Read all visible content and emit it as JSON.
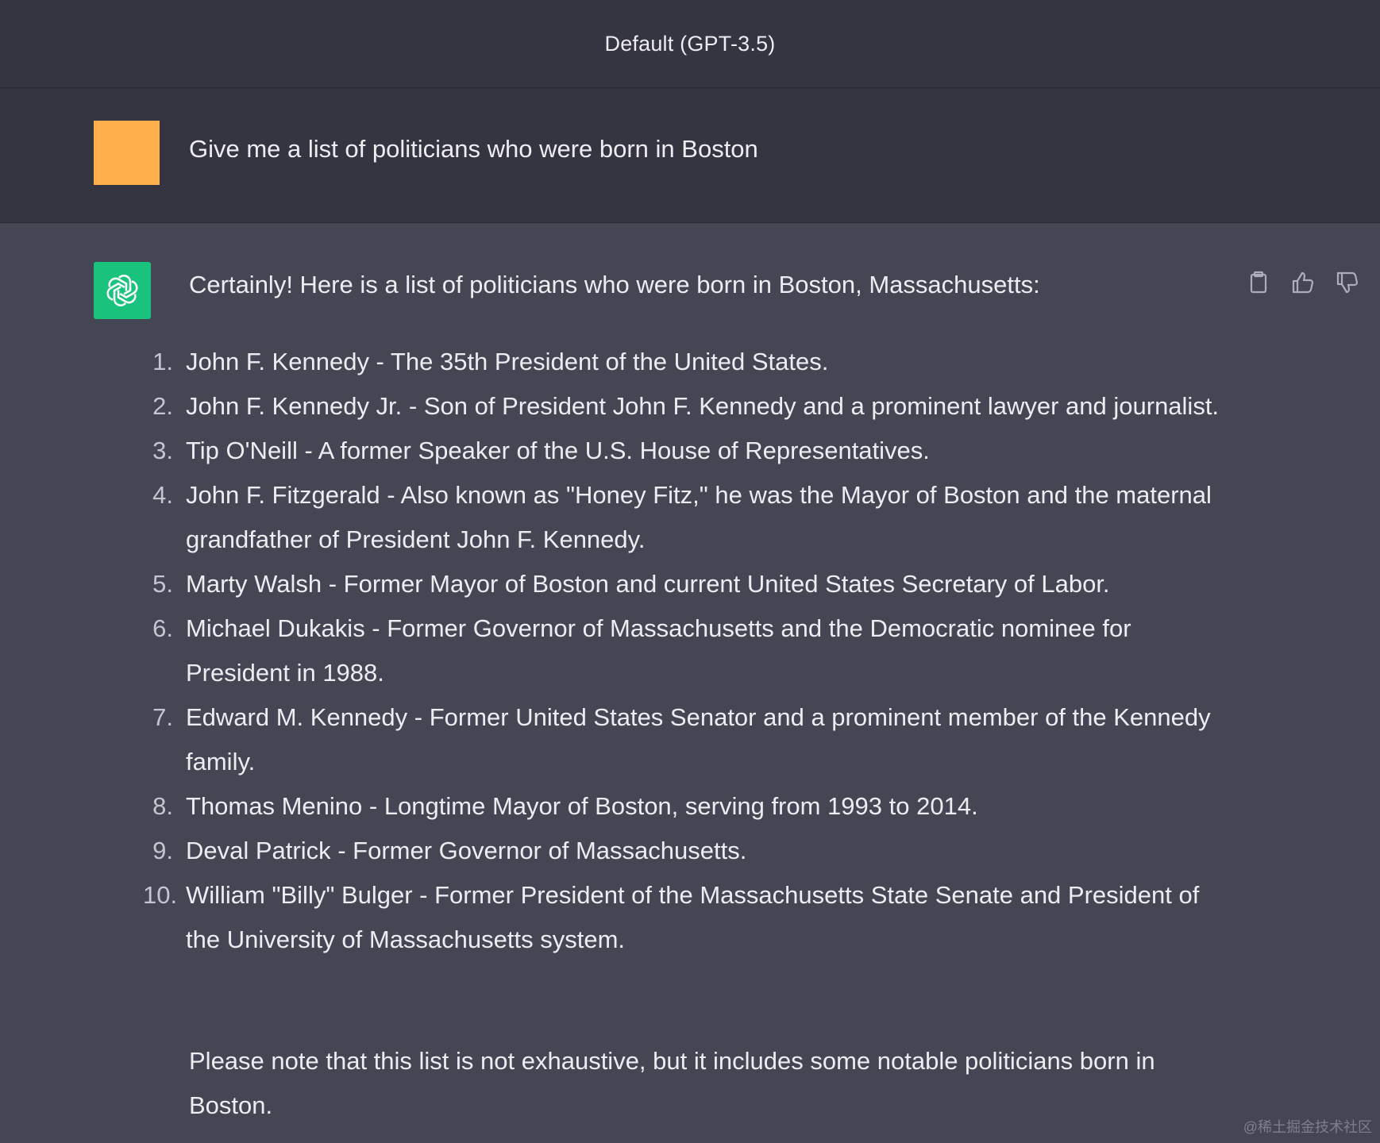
{
  "header": {
    "title": "Default (GPT-3.5)"
  },
  "user_message": {
    "text": "Give me a list of politicians who were born in Boston",
    "avatar_color": "#ffb04c"
  },
  "assistant_message": {
    "avatar_color": "#19c37d",
    "intro": "Certainly! Here is a list of politicians who were born in Boston, Massachusetts:",
    "items": [
      {
        "num": "1.",
        "text": "John F. Kennedy - The 35th President of the United States."
      },
      {
        "num": "2.",
        "text": "John F. Kennedy Jr. - Son of President John F. Kennedy and a prominent lawyer and journalist."
      },
      {
        "num": "3.",
        "text": "Tip O'Neill - A former Speaker of the U.S. House of Representatives."
      },
      {
        "num": "4.",
        "text": "John F. Fitzgerald - Also known as \"Honey Fitz,\" he was the Mayor of Boston and the maternal grandfather of President John F. Kennedy."
      },
      {
        "num": "5.",
        "text": "Marty Walsh - Former Mayor of Boston and current United States Secretary of Labor."
      },
      {
        "num": "6.",
        "text": "Michael Dukakis - Former Governor of Massachusetts and the Democratic nominee for President in 1988."
      },
      {
        "num": "7.",
        "text": "Edward M. Kennedy - Former United States Senator and a prominent member of the Kennedy family."
      },
      {
        "num": "8.",
        "text": "Thomas Menino - Longtime Mayor of Boston, serving from 1993 to 2014."
      },
      {
        "num": "9.",
        "text": "Deval Patrick - Former Governor of Massachusetts."
      },
      {
        "num": "10.",
        "text": "William \"Billy\" Bulger - Former President of the Massachusetts State Senate and President of the University of Massachusetts system."
      }
    ],
    "note": "Please note that this list is not exhaustive, but it includes some notable politicians born in Boston."
  },
  "actions": {
    "icons": [
      "clipboard-icon",
      "thumbs-up-icon",
      "thumbs-down-icon"
    ]
  },
  "watermark": "@稀土掘金技术社区"
}
